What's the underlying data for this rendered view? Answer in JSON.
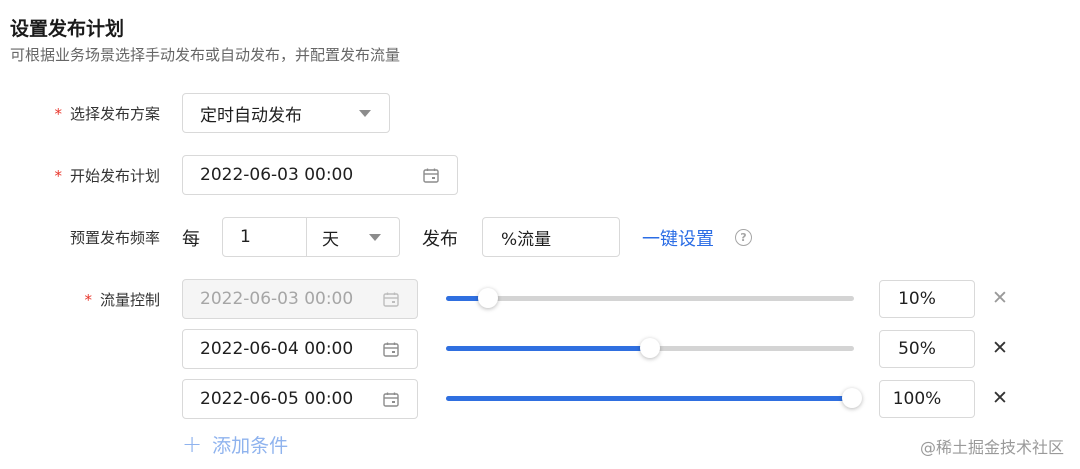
{
  "header": {
    "title": "设置发布计划",
    "subtitle": "可根据业务场景选择手动发布或自动发布，并配置发布流量"
  },
  "scheme": {
    "label": "选择发布方案",
    "value": "定时自动发布"
  },
  "start": {
    "label": "开始发布计划",
    "value": "2022-06-03 00:00"
  },
  "frequency": {
    "label": "预置发布频率",
    "prefix": "每",
    "count": "1",
    "unit": "天",
    "middle": "发布",
    "traffic_placeholder": "%流量",
    "one_click": "一键设置",
    "help": "?"
  },
  "traffic": {
    "label": "流量控制",
    "rows": [
      {
        "date": "2022-06-03 00:00",
        "percent": "10%",
        "level": 0.1,
        "disabled": true
      },
      {
        "date": "2022-06-04 00:00",
        "percent": "50%",
        "level": 0.5,
        "disabled": false
      },
      {
        "date": "2022-06-05 00:00",
        "percent": "100%",
        "level": 1.0,
        "disabled": false
      }
    ]
  },
  "add_condition": {
    "icon": "+",
    "label": "添加条件"
  },
  "watermark": "@稀土掘金技术社区",
  "colors": {
    "accent": "#2f6fe0",
    "required": "#e8372c",
    "link": "#2b6de5"
  }
}
